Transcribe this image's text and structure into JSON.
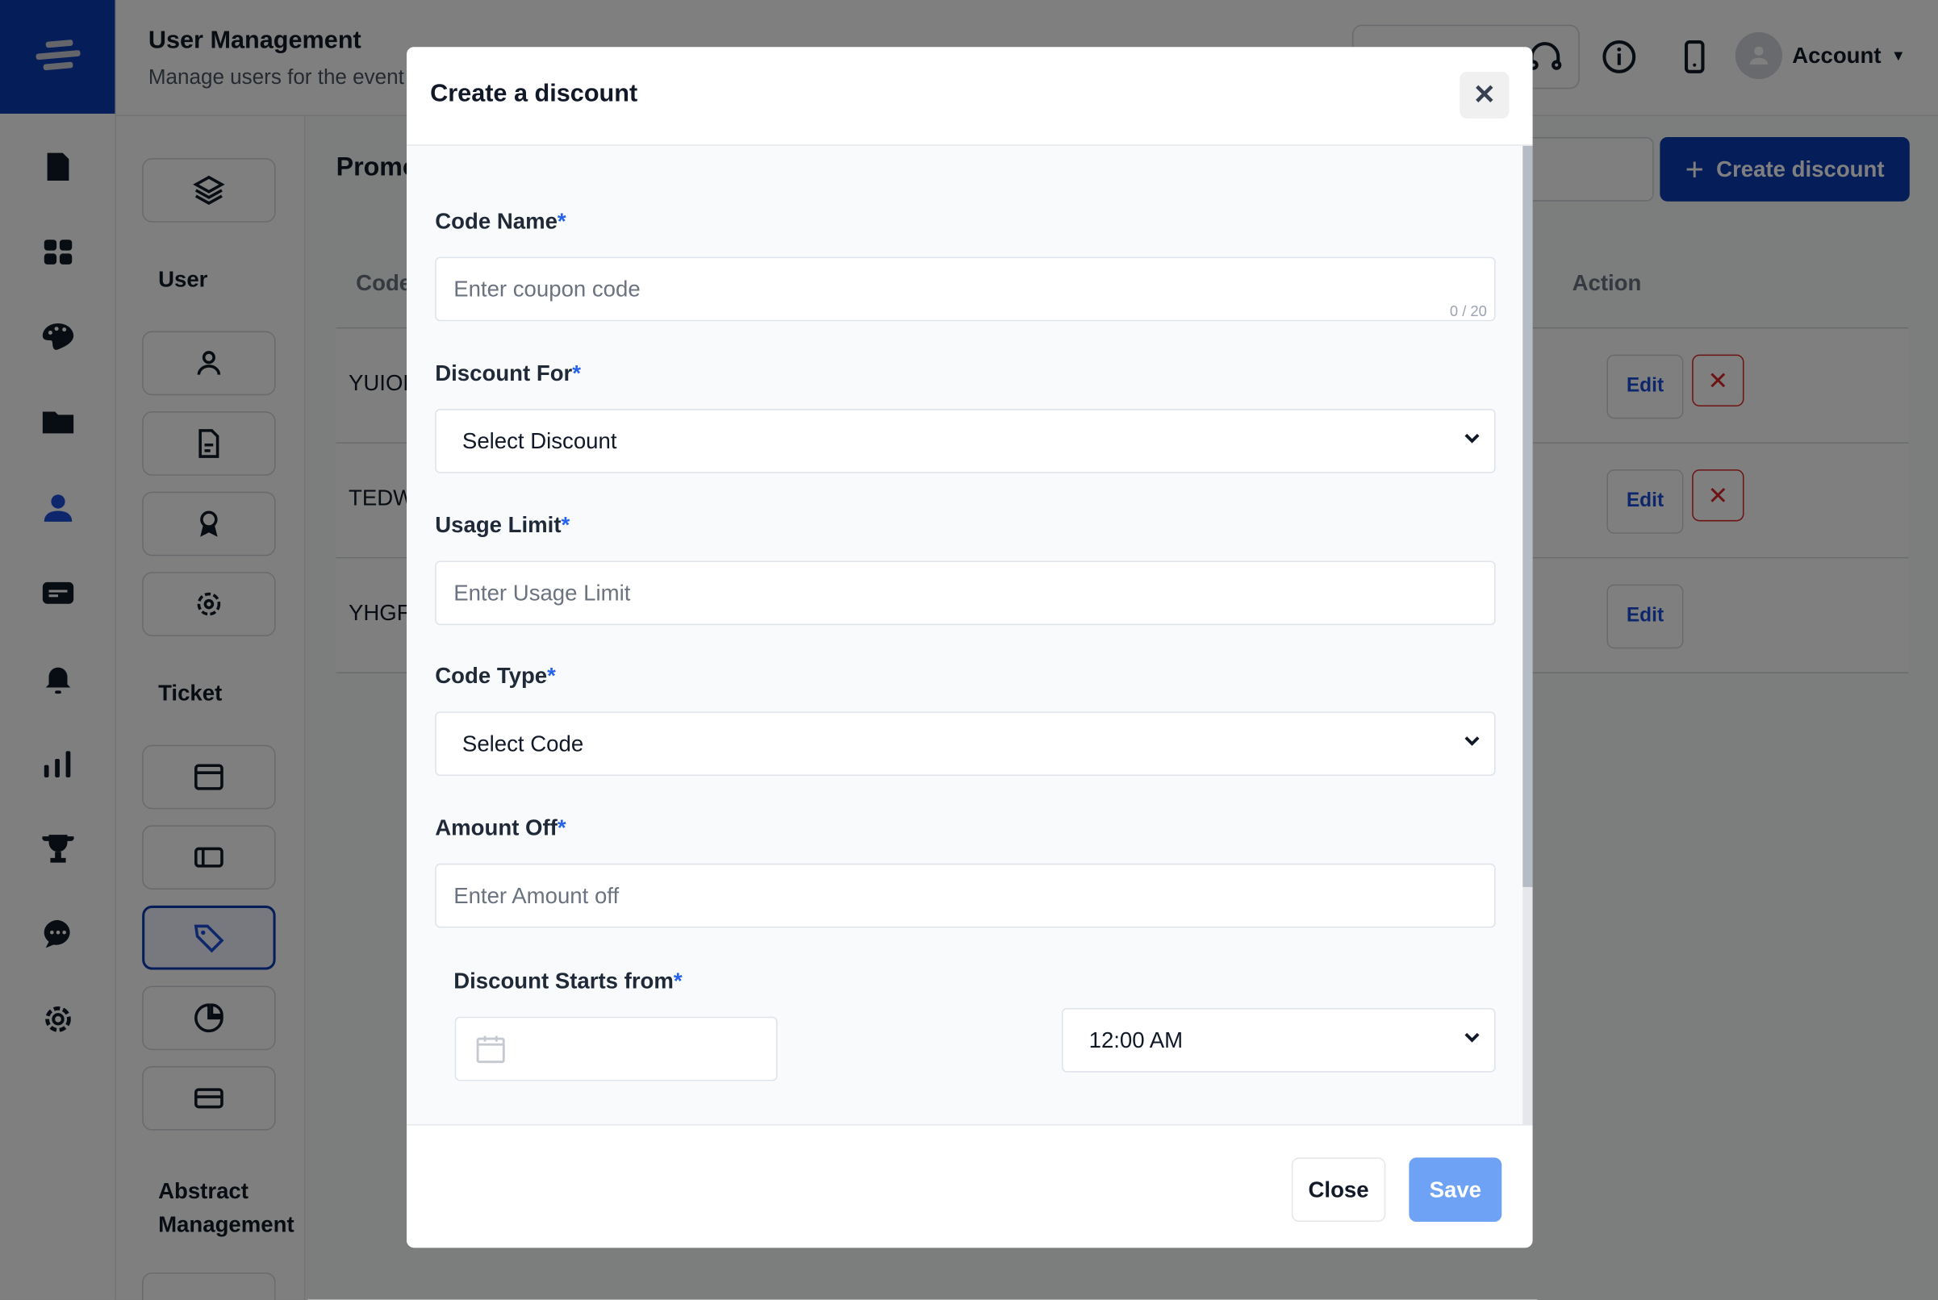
{
  "header": {
    "title": "User Management",
    "subtitle": "Manage users for the event",
    "account_label": "Account"
  },
  "subnav": {
    "sections": [
      "User",
      "Ticket",
      "Abstract Management"
    ]
  },
  "main": {
    "page_title": "Promo Codes",
    "create_button": "Create discount",
    "columns": {
      "code": "Code",
      "action": "Action"
    },
    "rows": [
      {
        "code": "YUIOP",
        "edit": "Edit",
        "delete": "✕"
      },
      {
        "code": "TEDW",
        "edit": "Edit",
        "delete": "✕"
      },
      {
        "code": "YHGF",
        "edit": "Edit"
      }
    ]
  },
  "modal": {
    "title": "Create a discount",
    "close_icon": "✕",
    "code_name": {
      "label": "Code Name",
      "placeholder": "Enter coupon code",
      "counter": "0 / 20"
    },
    "discount_for": {
      "label": "Discount For",
      "value": "Select Discount"
    },
    "usage_limit": {
      "label": "Usage Limit",
      "placeholder": "Enter Usage Limit"
    },
    "code_type": {
      "label": "Code Type",
      "value": "Select Code"
    },
    "amount_off": {
      "label": "Amount Off",
      "placeholder": "Enter Amount off"
    },
    "starts_from": {
      "label": "Discount Starts from",
      "time": "12:00 AM"
    },
    "required_mark": "*",
    "close_button": "Close",
    "save_button": "Save"
  },
  "colors": {
    "brand": "#0b3bb0",
    "save": "#6ea2f5",
    "danger": "#dc2626",
    "required": "#2563eb"
  }
}
